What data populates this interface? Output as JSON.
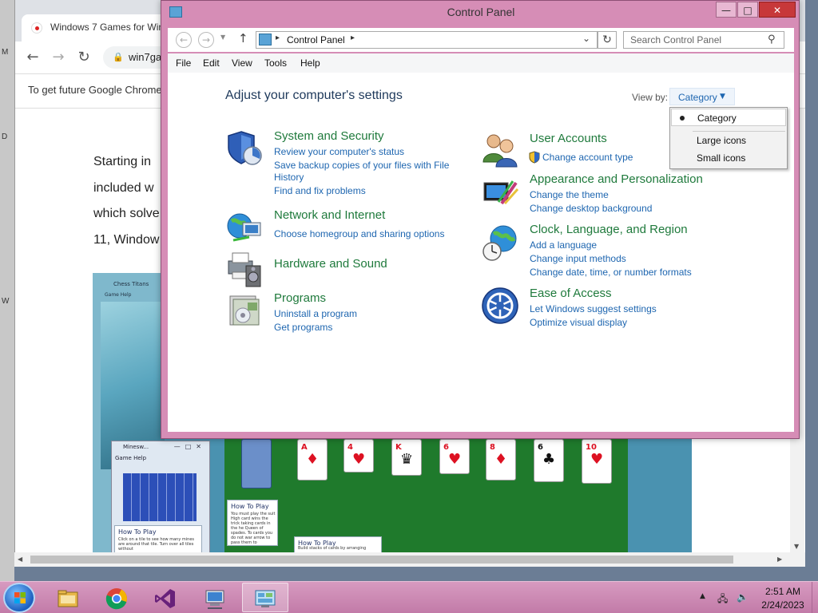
{
  "browser": {
    "tab_title": "Windows 7 Games for Win",
    "url": "win7ga",
    "infobar": "To get future Google Chrome",
    "article_lines": [
      "Starting in",
      "included w",
      "which solve",
      "11, Window"
    ],
    "side_letters": [
      "M",
      "D",
      "W"
    ],
    "embedded_image": {
      "chess_title": "Chess Titans",
      "chess_menu": "Game    Help",
      "minesweeper_title": "Minesw...",
      "minesweeper_menu": "Game   Help",
      "howto_title": "How To Play",
      "howto_text_1": "Click on a tile to see how many mines are around that tile. Turn over all tiles without",
      "howto_text_2": "You must play the suit High card wins the trick taking cards in the he Queen of spades. To cards you do not war arrow to pass them to",
      "howto_text_3": "Build stacks of cards by arranging"
    }
  },
  "control_panel": {
    "window_title": "Control Panel",
    "address": "Control Panel",
    "search_placeholder": "Search Control Panel",
    "menu": [
      "File",
      "Edit",
      "View",
      "Tools",
      "Help"
    ],
    "heading": "Adjust your computer's settings",
    "view_by_label": "View by:",
    "view_by_value": "Category",
    "categories_left": [
      {
        "title": "System and Security",
        "links": [
          "Review your computer's status",
          "Save backup copies of your files with File",
          "History",
          "Find and fix problems"
        ]
      },
      {
        "title": "Network and Internet",
        "links": [
          "Choose homegroup and sharing options"
        ]
      },
      {
        "title": "Hardware and Sound",
        "links": []
      },
      {
        "title": "Programs",
        "links": [
          "Uninstall a program",
          "Get programs"
        ]
      }
    ],
    "categories_right": [
      {
        "title": "User Accounts",
        "links": [
          "Change account type"
        ]
      },
      {
        "title": "Appearance and Personalization",
        "links": [
          "Change the theme",
          "Change desktop background"
        ]
      },
      {
        "title": "Clock, Language, and Region",
        "links": [
          "Add a language",
          "Change input methods",
          "Change date, time, or number formats"
        ]
      },
      {
        "title": "Ease of Access",
        "links": [
          "Let Windows suggest settings",
          "Optimize visual display"
        ]
      }
    ],
    "view_options": [
      "Category",
      "Large icons",
      "Small icons"
    ],
    "selected_view": "Category"
  },
  "taskbar": {
    "apps": [
      "file-explorer-icon",
      "chrome-icon",
      "visual-studio-icon",
      "remote-desktop-icon",
      "control-panel-icon"
    ],
    "active_app": "control-panel-icon",
    "time": "2:51 AM",
    "date": "2/24/2023"
  },
  "colors": {
    "window_frame": "#d68db6",
    "category_title": "#1f7a3c",
    "link": "#1e66b0",
    "heading": "#1e395b"
  }
}
